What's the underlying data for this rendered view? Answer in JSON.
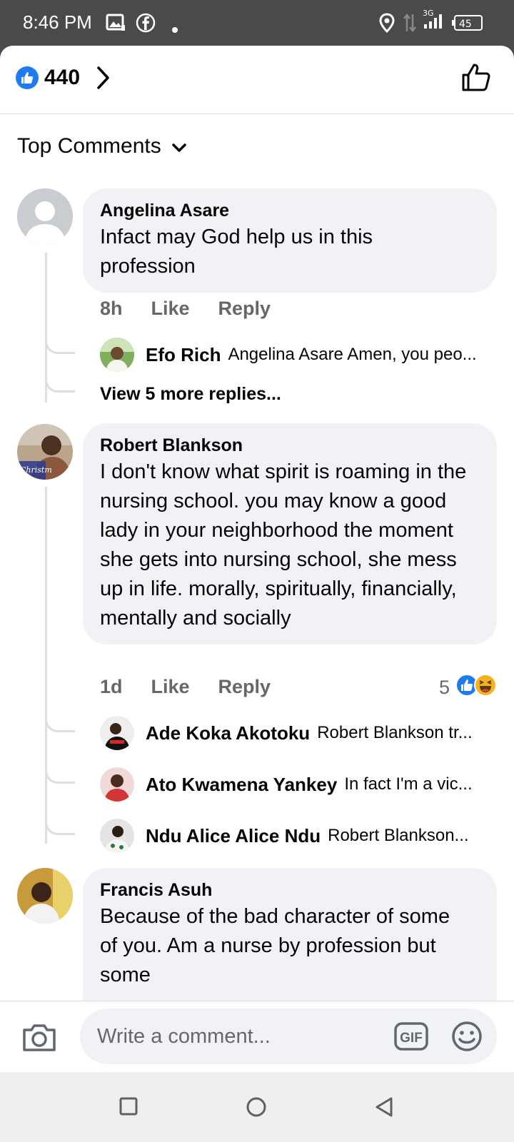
{
  "status": {
    "time": "8:46 PM",
    "network": "3G",
    "battery": "45"
  },
  "header": {
    "like_count": "440"
  },
  "sort_label": "Top Comments",
  "comments": [
    {
      "name": "Angelina Asare",
      "text": "Infact may God help us in this profession",
      "time": "8h",
      "like": "Like",
      "reply": "Reply",
      "replies": [
        {
          "name": "Efo Rich",
          "text": "Angelina Asare Amen, you peo..."
        }
      ],
      "view_more": "View 5 more replies..."
    },
    {
      "name": "Robert Blankson",
      "text": "I don't know what spirit is roaming in the nursing school. you may know a good lady in your neighborhood the moment she gets into nursing school, she mess up in life. morally, spiritually, financially, mentally and socially",
      "time": "1d",
      "like": "Like",
      "reply": "Reply",
      "reaction_count": "5",
      "replies": [
        {
          "name": "Ade Koka Akotoku",
          "text": "Robert Blankson tr..."
        },
        {
          "name": "Ato Kwamena Yankey",
          "text": "In fact I'm a  vic..."
        },
        {
          "name": "Ndu Alice Alice Ndu",
          "text": "Robert Blankson..."
        }
      ]
    },
    {
      "name": "Francis Asuh",
      "text": "Because of the bad character of some of you. Am a nurse by profession but some"
    }
  ],
  "composer": {
    "placeholder": "Write a comment...",
    "gif_label": "GIF"
  },
  "colors": {
    "accent": "#1f7bf2",
    "bubble": "#f0f2f5",
    "meta": "#65676b"
  }
}
